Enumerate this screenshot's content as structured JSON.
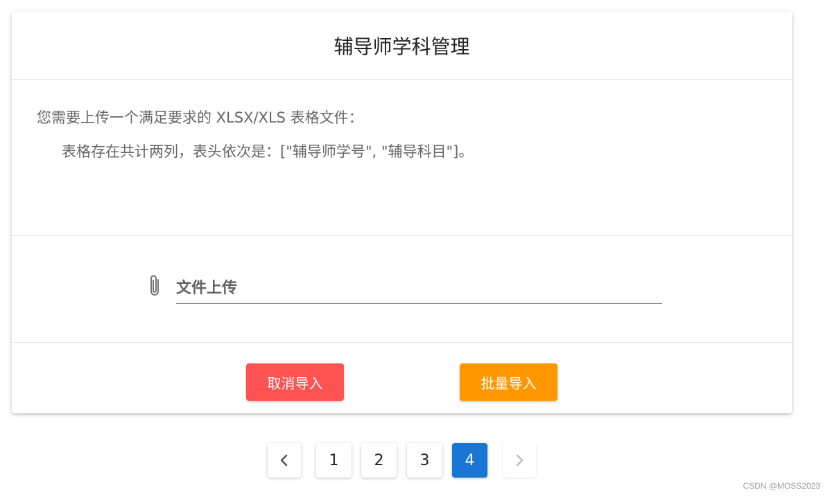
{
  "dialog": {
    "title": "辅导师学科管理",
    "description_line1": "您需要上传一个满足要求的 XLSX/XLS 表格文件：",
    "description_line2": "表格存在共计两列，表头依次是：[\"辅导师学号\", \"辅导科目\"]。",
    "upload": {
      "icon": "paperclip-icon",
      "label": "文件上传"
    },
    "buttons": {
      "cancel_label": "取消导入",
      "cancel_color": "#ff5252",
      "import_label": "批量导入",
      "import_color": "#ff9800"
    }
  },
  "pagination": {
    "prev_icon": "chevron-left-icon",
    "next_icon": "chevron-right-icon",
    "pages": [
      "1",
      "2",
      "3",
      "4"
    ],
    "current_page": "4",
    "active_color": "#1976d2"
  },
  "watermark": "CSDN @MOSS2023"
}
